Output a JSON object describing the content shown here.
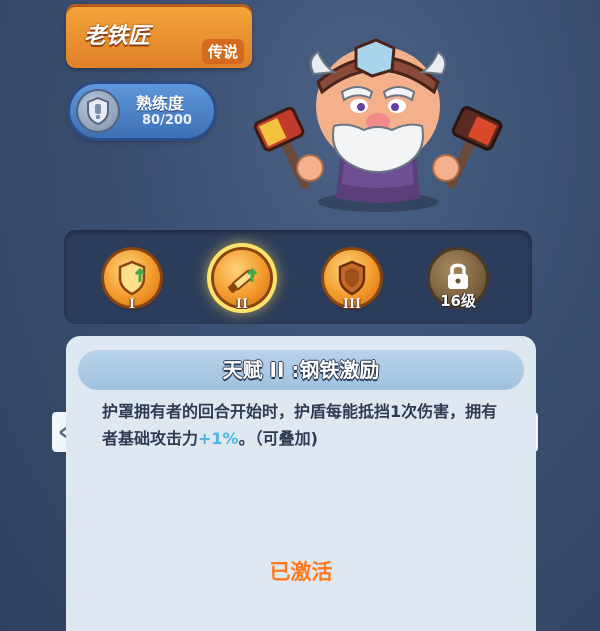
{
  "hero": {
    "name": "老铁匠",
    "rarity": "传说"
  },
  "proficiency": {
    "label": "熟练度",
    "value": "80/200"
  },
  "talents": [
    {
      "roman": "I",
      "state": "unlocked",
      "icon": "shield-up-icon"
    },
    {
      "roman": "II",
      "state": "selected",
      "icon": "sword-up-icon"
    },
    {
      "roman": "III",
      "state": "unlocked",
      "icon": "shield-icon"
    },
    {
      "level": "16级",
      "state": "locked",
      "icon": "lock-icon"
    }
  ],
  "detail": {
    "title": "天赋 II :钢铁激励",
    "desc_before": "护罩拥有者的回合开始时，护盾每能抵挡1次伤害，拥有者基础攻击力",
    "desc_highlight": "+1%",
    "desc_after": "。（可叠加)",
    "status": "已激活"
  },
  "colors": {
    "accent_orange": "#ff7a1a",
    "highlight_blue": "#4fb4e8",
    "panel_bg": "#dfe7f1"
  }
}
